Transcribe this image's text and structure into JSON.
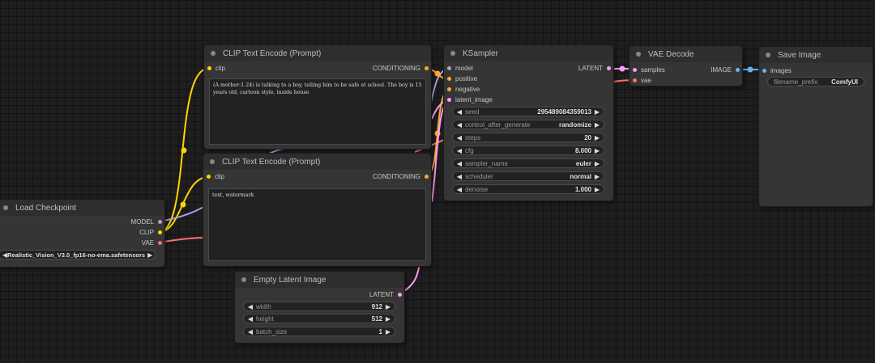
{
  "colors": {
    "clip": "#ffd500",
    "conditioning": "#ffa931",
    "model": "#b39ddb",
    "latent": "#ff9cf9",
    "vae": "#ff6e6e",
    "image": "#64b5f6"
  },
  "nodes": {
    "clip_pos": {
      "title": "CLIP Text Encode (Prompt)",
      "in_clip": "clip",
      "out_cond": "CONDITIONING",
      "text": "(A mother:1.24) is talking to a boy, telling him to be safe at school. The boy is 15 years old, cartoon style, inside house"
    },
    "clip_neg": {
      "title": "CLIP Text Encode (Prompt)",
      "in_clip": "clip",
      "out_cond": "CONDITIONING",
      "text": "text, watermark"
    },
    "ksampler": {
      "title": "KSampler",
      "in_model": "model",
      "in_positive": "positive",
      "in_negative": "negative",
      "in_latent": "latent_image",
      "out_latent": "LATENT",
      "widgets": [
        {
          "label": "seed",
          "value": "295489084359013"
        },
        {
          "label": "control_after_generate",
          "value": "randomize"
        },
        {
          "label": "steps",
          "value": "20"
        },
        {
          "label": "cfg",
          "value": "8.000"
        },
        {
          "label": "sampler_name",
          "value": "euler"
        },
        {
          "label": "scheduler",
          "value": "normal"
        },
        {
          "label": "denoise",
          "value": "1.000"
        }
      ]
    },
    "vae_decode": {
      "title": "VAE Decode",
      "in_samples": "samples",
      "in_vae": "vae",
      "out_image": "IMAGE"
    },
    "save_image": {
      "title": "Save Image",
      "in_images": "images",
      "widget": {
        "label": "filename_prefix",
        "value": "ComfyUI"
      }
    },
    "checkpoint": {
      "title": "Load Checkpoint",
      "out_model": "MODEL",
      "out_clip": "CLIP",
      "out_vae": "VAE",
      "widget_value": "Realistic_Vision_V3.0_fp16-no-ema.safetensors"
    },
    "empty_latent": {
      "title": "Empty Latent Image",
      "out_latent": "LATENT",
      "widgets": [
        {
          "label": "width",
          "value": "912"
        },
        {
          "label": "height",
          "value": "512"
        },
        {
          "label": "batch_size",
          "value": "1"
        }
      ]
    }
  }
}
